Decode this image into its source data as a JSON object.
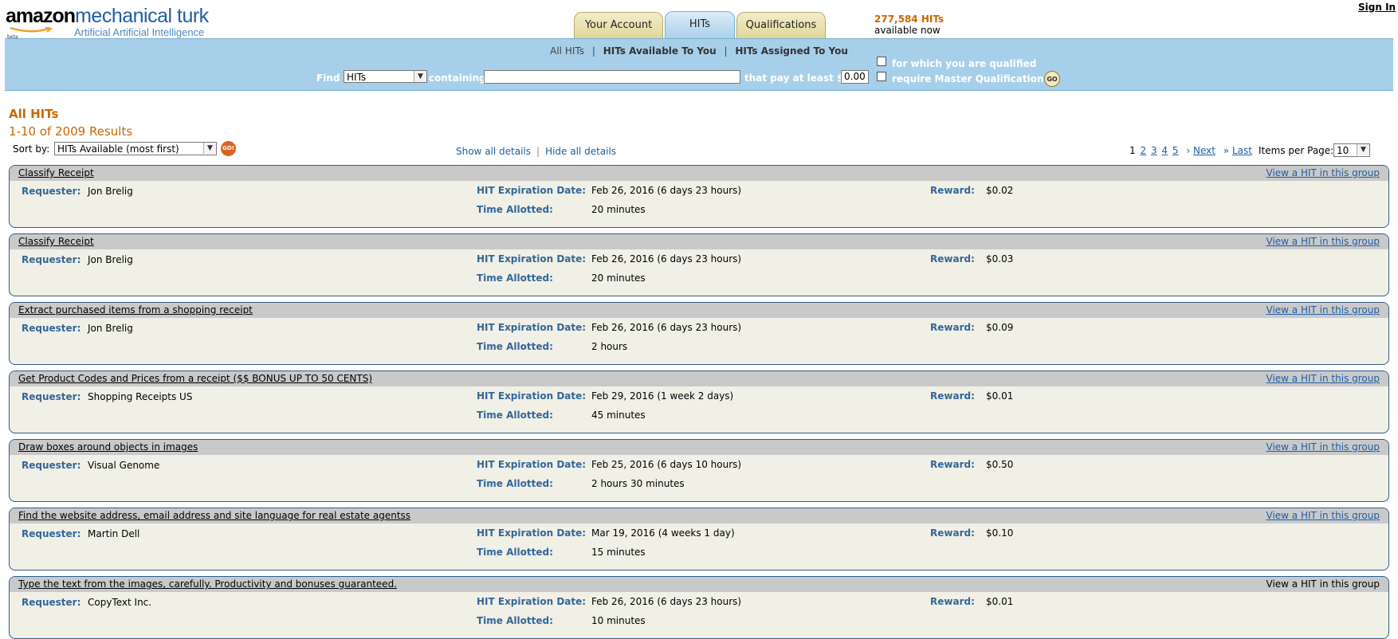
{
  "header": {
    "logo_amazon": "amazon",
    "logo_mturk": "mechanical turk",
    "tagline": "Artificial Artificial Intelligence",
    "beta": "beta",
    "tabs": [
      {
        "label": "Your Account",
        "active": false
      },
      {
        "label": "HITs",
        "active": true
      },
      {
        "label": "Qualifications",
        "active": false
      }
    ],
    "hits_available_count": "277,584 HITs",
    "hits_available_suffix": "available now",
    "sign_in": "Sign In"
  },
  "search": {
    "subnav": [
      "All HITs",
      "HITs Available To You",
      "HITs Assigned To You"
    ],
    "find_label": "Find",
    "find_select_value": "HITs",
    "containing_label": "containing",
    "containing_value": "",
    "pay_label": "that pay at least $",
    "pay_value": "0.00",
    "qualified_label": "for which you are qualified",
    "master_label": "require Master Qualification",
    "go_label": "GO"
  },
  "results": {
    "title": "All HITs",
    "count": "1-10 of 2009 Results",
    "sort_label": "Sort by:",
    "sort_value": "HITs Available (most first)",
    "go_label": "GO!",
    "show_all": "Show all details",
    "hide_all": "Hide all details",
    "pages": [
      "1",
      "2",
      "3",
      "4",
      "5"
    ],
    "next": "Next",
    "last": "Last",
    "items_per_page_label": "Items per Page:",
    "items_per_page_value": "10"
  },
  "labels": {
    "requester": "Requester:",
    "expiration": "HIT Expiration Date:",
    "time_allotted": "Time Allotted:",
    "reward": "Reward:"
  },
  "hits": [
    {
      "title": "Classify Receipt",
      "view": "View a HIT in this group",
      "requester": "Jon Brelig",
      "expiration": "Feb 26, 2016  (6 days 23 hours)",
      "time": "20 minutes",
      "reward": "$0.02"
    },
    {
      "title": "Classify Receipt",
      "view": "View a HIT in this group",
      "requester": "Jon Brelig",
      "expiration": "Feb 26, 2016  (6 days 23 hours)",
      "time": "20 minutes",
      "reward": "$0.03"
    },
    {
      "title": "Extract purchased items from a shopping receipt",
      "view": "View a HIT in this group",
      "requester": "Jon Brelig",
      "expiration": "Feb 26, 2016  (6 days 23 hours)",
      "time": "2 hours",
      "reward": "$0.09"
    },
    {
      "title": "Get Product Codes and Prices from a receipt ($$ BONUS UP TO 50 CENTS)",
      "view": "View a HIT in this group",
      "requester": "Shopping Receipts US",
      "expiration": "Feb 29, 2016  (1 week 2 days)",
      "time": "45 minutes",
      "reward": "$0.01"
    },
    {
      "title": "Draw boxes around objects in images",
      "view": "View a HIT in this group",
      "requester": "Visual Genome",
      "expiration": "Feb 25, 2016  (6 days 10 hours)",
      "time": "2 hours 30 minutes",
      "reward": "$0.50"
    },
    {
      "title": "Find the website address, email address and site language for real estate agentss",
      "view": "View a HIT in this group",
      "requester": "Martin Dell",
      "expiration": "Mar 19, 2016  (4 weeks 1 day)",
      "time": "15 minutes",
      "reward": "$0.10"
    },
    {
      "title": "Type the text from the images, carefully. Productivity and bonuses guaranteed.",
      "view": "View a HIT in this group",
      "view_is_link": false,
      "requester": "CopyText Inc.",
      "expiration": "Feb 26, 2016  (6 days 23 hours)",
      "time": "10 minutes",
      "reward": "$0.01"
    }
  ]
}
